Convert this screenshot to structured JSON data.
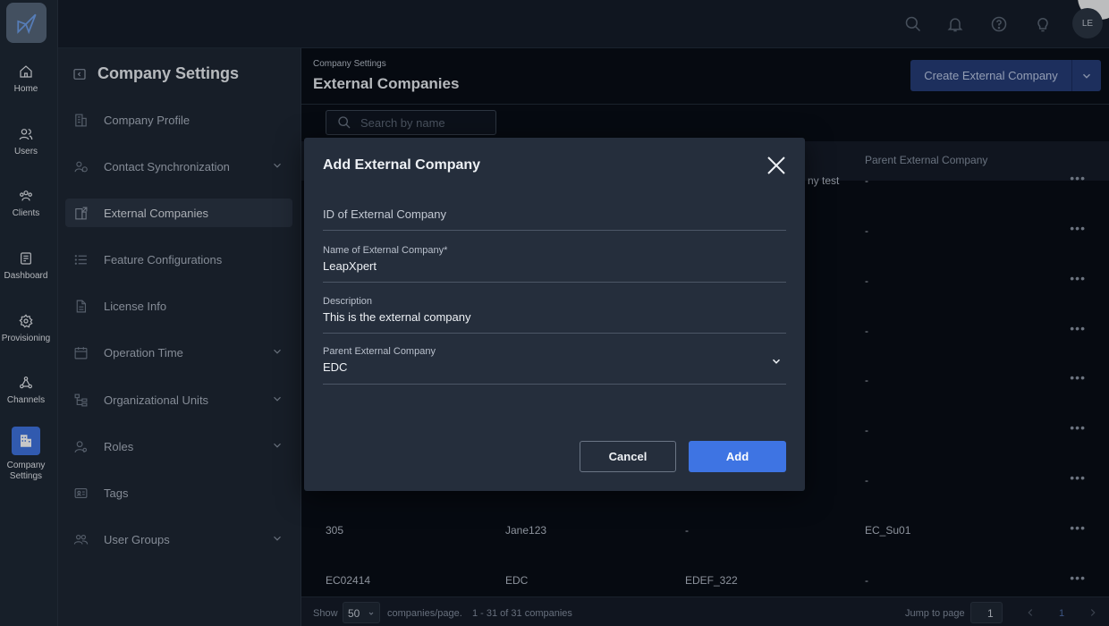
{
  "rail": {
    "items": [
      {
        "label": "Home",
        "icon": "home-icon"
      },
      {
        "label": "Users",
        "icon": "users-icon"
      },
      {
        "label": "Clients",
        "icon": "clients-icon"
      },
      {
        "label": "Dashboard",
        "icon": "dashboard-icon"
      },
      {
        "label": "Provisioning",
        "icon": "gear-icon"
      },
      {
        "label": "Channels",
        "icon": "channels-icon"
      },
      {
        "label": "Company Settings",
        "icon": "building-icon"
      }
    ]
  },
  "topbar": {
    "avatar_initials": "LE"
  },
  "settings": {
    "title": "Company Settings",
    "items": [
      {
        "label": "Company Profile"
      },
      {
        "label": "Contact Synchronization"
      },
      {
        "label": "External Companies"
      },
      {
        "label": "Feature Configurations"
      },
      {
        "label": "License Info"
      },
      {
        "label": "Operation Time"
      },
      {
        "label": "Organizational Units"
      },
      {
        "label": "Roles"
      },
      {
        "label": "Tags"
      },
      {
        "label": "User Groups"
      }
    ]
  },
  "main": {
    "breadcrumb": "Company Settings",
    "title": "External Companies",
    "create_button": "Create External Company",
    "search_placeholder": "Search by name",
    "columns": {
      "parent": "Parent External Company"
    },
    "partial_cell": "ny test",
    "rows": [
      {
        "parent": "-"
      },
      {
        "parent": "-"
      },
      {
        "parent": "-"
      },
      {
        "parent": "-"
      },
      {
        "parent": "-"
      },
      {
        "parent": "-"
      },
      {
        "parent": "-"
      },
      {
        "id": "305",
        "name": "Jane123",
        "description": "-",
        "parent": "EC_Su01"
      },
      {
        "id": "EC02414",
        "name": "EDC",
        "description": "EDEF_322",
        "parent": "-"
      }
    ],
    "row_actions": "•••",
    "footer": {
      "show_label": "Show",
      "per_page": "50",
      "per_page_suffix": "companies/page.",
      "range": "1 - 31 of 31 companies",
      "jump_label": "Jump to page",
      "jump_value": "1",
      "current_page": "1"
    }
  },
  "modal": {
    "title": "Add External Company",
    "fields": {
      "id": {
        "placeholder": "ID of External Company"
      },
      "name": {
        "label": "Name of External Company*",
        "value": "LeapXpert"
      },
      "description": {
        "label": "Description",
        "value": "This is the external company"
      },
      "parent": {
        "label": "Parent External Company",
        "value": "EDC"
      }
    },
    "cancel": "Cancel",
    "add": "Add"
  },
  "colors": {
    "accent": "#3e74e3",
    "modal_bg": "#252e3c",
    "page_bg": "#080d16"
  }
}
